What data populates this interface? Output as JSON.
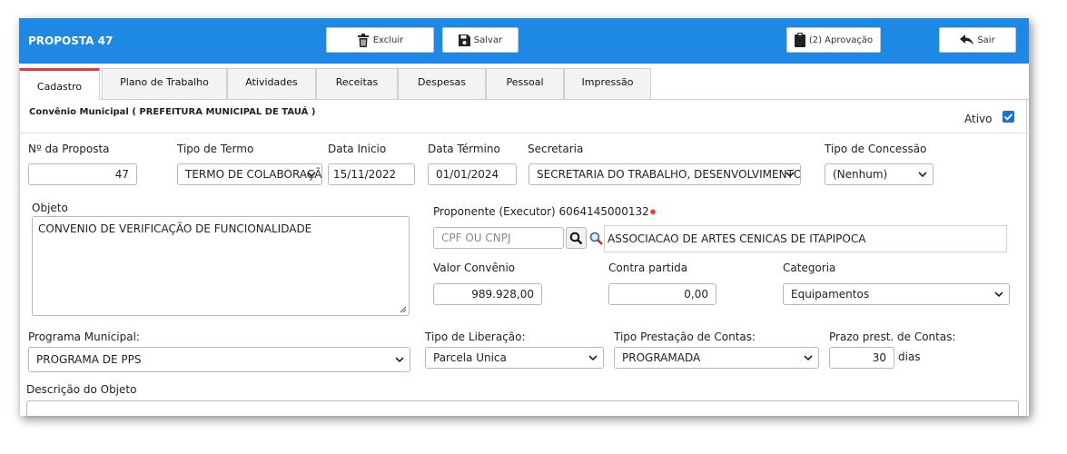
{
  "header": {
    "title": "PROPOSTA 47",
    "buttons": {
      "excluir": "Excluir",
      "salvar": "Salvar",
      "aprovacao": "(2) Aprovação",
      "sair": "Sair"
    }
  },
  "tabs": [
    "Cadastro",
    "Plano de Trabalho",
    "Atividades",
    "Receitas",
    "Despesas",
    "Pessoal",
    "Impressão"
  ],
  "active_tab": "Cadastro",
  "section": {
    "title": "Convênio Municipal ( PREFEITURA MUNICIPAL DE TAUÁ )",
    "ativo_label": "Ativo",
    "ativo_checked": true
  },
  "form": {
    "numero": {
      "label": "Nº da Proposta",
      "value": "47"
    },
    "tipo_termo": {
      "label": "Tipo de Termo",
      "value": "TERMO DE COLABORAÇÃO"
    },
    "data_inicio": {
      "label": "Data Inicio",
      "value": "15/11/2022"
    },
    "data_termino": {
      "label": "Data Término",
      "value": "01/01/2024"
    },
    "secretaria": {
      "label": "Secretaria",
      "value": "SECRETARIA DO TRABALHO, DESENVOLVIMENTO"
    },
    "tipo_concessao": {
      "label": "Tipo de Concessão",
      "value": "(Nenhum)"
    },
    "objeto": {
      "label": "Objeto",
      "value": "CONVENIO DE VERIFICAÇÃO DE FUNCIONALIDADE"
    },
    "proponente": {
      "label": "Proponente (Executor) 6064145000132",
      "placeholder": "CPF OU CNPJ",
      "name": "ASSOCIACAO DE ARTES CENICAS DE ITAPIPOCA"
    },
    "valor_convenio": {
      "label": "Valor Convênio",
      "value": "989.928,00"
    },
    "contra_partida": {
      "label": "Contra partida",
      "value": "0,00"
    },
    "categoria": {
      "label": "Categoria",
      "value": "Equipamentos"
    },
    "programa": {
      "label": "Programa Municipal:",
      "value": "PROGRAMA DE PPS"
    },
    "tipo_liberacao": {
      "label": "Tipo de Liberação:",
      "value": "Parcela Unica"
    },
    "tipo_prestacao": {
      "label": "Tipo Prestação de Contas:",
      "value": "PROGRAMADA"
    },
    "prazo": {
      "label": "Prazo prest. de Contas:",
      "value": "30",
      "unit": "dias"
    },
    "descricao": {
      "label": "Descrição do Objeto",
      "value": ""
    }
  },
  "colors": {
    "topbar": "#1e88e5",
    "active_tab_border": "#e53935",
    "checkbox": "#1e6fd9"
  }
}
